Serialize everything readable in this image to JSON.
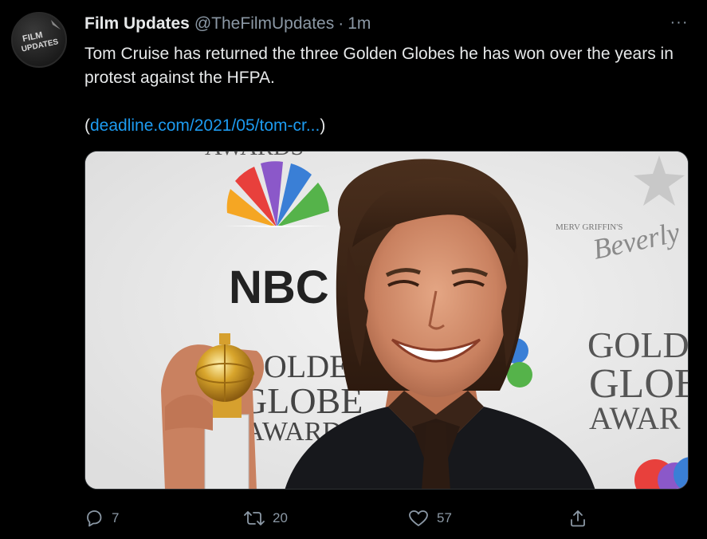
{
  "author": {
    "display_name": "Film Updates",
    "handle": "@TheFilmUpdates",
    "separator": "·",
    "time": "1m",
    "avatar_text_line1": "FILM",
    "avatar_text_line2": "UPDATES"
  },
  "tweet": {
    "text": "Tom Cruise has returned the three Golden Globes he has won over the years in protest against the HFPA.",
    "link_open": "(",
    "link_text": "deadline.com/2021/05/tom-cr...",
    "link_close": ")",
    "more_label": "···"
  },
  "media": {
    "backdrop_text": {
      "nbc": "NBC",
      "golden": "GOLDEN",
      "globe": "GLOBE",
      "awards": "AWARDS",
      "merv": "MERV GRIFFIN'S",
      "beverly": "Beverly",
      "right_golden": "GOLD",
      "right_globe": "GLOB",
      "right_awards": "AWAR"
    }
  },
  "actions": {
    "reply_count": "7",
    "retweet_count": "20",
    "like_count": "57"
  },
  "colors": {
    "background": "#000000",
    "text": "#e7e9ea",
    "muted": "#8b98a5",
    "link": "#1d9bf0"
  }
}
